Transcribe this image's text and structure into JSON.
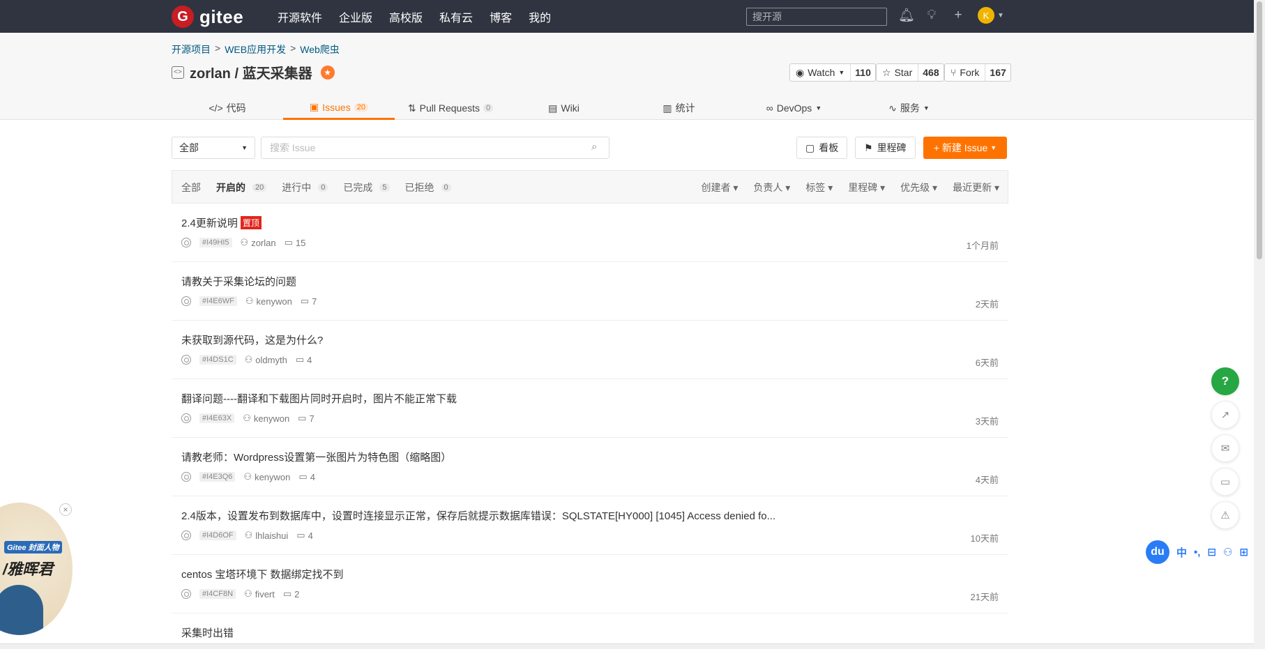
{
  "topbar": {
    "logo_text": "gitee",
    "nav": [
      "开源软件",
      "企业版",
      "高校版",
      "私有云",
      "博客",
      "我的"
    ],
    "search_placeholder": "搜开源",
    "avatar_letter": "K"
  },
  "breadcrumb": [
    "开源项目",
    "WEB应用开发",
    "Web爬虫"
  ],
  "project": {
    "owner_repo": "zorlan / 蓝天采集器",
    "watch_label": "Watch",
    "watch_count": "110",
    "star_label": "Star",
    "star_count": "468",
    "fork_label": "Fork",
    "fork_count": "167"
  },
  "tabs": [
    {
      "label": "代码",
      "icon": "code-icon"
    },
    {
      "label": "Issues",
      "count": "20",
      "icon": "issues-icon"
    },
    {
      "label": "Pull Requests",
      "count": "0",
      "icon": "pull-request-icon"
    },
    {
      "label": "Wiki",
      "icon": "wiki-icon"
    },
    {
      "label": "统计",
      "icon": "stats-icon"
    },
    {
      "label": "DevOps",
      "icon": "devops-icon"
    },
    {
      "label": "服务",
      "icon": "service-icon"
    }
  ],
  "toolbar": {
    "select_value": "全部",
    "search_placeholder": "搜索 Issue",
    "board_label": "看板",
    "milestone_label": "里程碑",
    "new_issue_label": "+ 新建 Issue"
  },
  "filters": {
    "left": [
      {
        "label": "全部"
      },
      {
        "label": "开启的",
        "count": "20"
      },
      {
        "label": "进行中",
        "count": "0"
      },
      {
        "label": "已完成",
        "count": "5"
      },
      {
        "label": "已拒绝",
        "count": "0"
      }
    ],
    "right": [
      "创建者",
      "负责人",
      "标签",
      "里程碑",
      "优先级",
      "最近更新"
    ]
  },
  "issues": [
    {
      "title": "2.4更新说明",
      "pinned": "置顶",
      "id": "#I49HI5",
      "author": "zorlan",
      "comments": "15",
      "time": "1个月前"
    },
    {
      "title": "请教关于采集论坛的问题",
      "id": "#I4E6WF",
      "author": "kenywon",
      "comments": "7",
      "time": "2天前"
    },
    {
      "title": "未获取到源代码，这是为什么?",
      "id": "#I4DS1C",
      "author": "oldmyth",
      "comments": "4",
      "time": "6天前"
    },
    {
      "title": "翻译问题----翻译和下载图片同时开启时，图片不能正常下载",
      "id": "#I4E63X",
      "author": "kenywon",
      "comments": "7",
      "time": "3天前"
    },
    {
      "title": "请教老师：Wordpress设置第一张图片为特色图（缩略图）",
      "id": "#I4E3Q6",
      "author": "kenywon",
      "comments": "4",
      "time": "4天前"
    },
    {
      "title": "2.4版本，设置发布到数据库中，设置时连接显示正常，保存后就提示数据库错误：SQLSTATE[HY000] [1045] Access denied fo...",
      "id": "#I4D6OF",
      "author": "lhlaishui",
      "comments": "4",
      "time": "10天前"
    },
    {
      "title": "centos 宝塔环境下 数据绑定找不到",
      "id": "#I4CF8N",
      "author": "fivert",
      "comments": "2",
      "time": "21天前"
    },
    {
      "title": "采集时出错"
    }
  ],
  "ime": {
    "logo": "du",
    "items": [
      "中",
      "•,",
      "⊟",
      "⚇",
      "⊞"
    ]
  },
  "promo": {
    "tag": "Gitee 封面人物",
    "text": "/雅晖君"
  }
}
